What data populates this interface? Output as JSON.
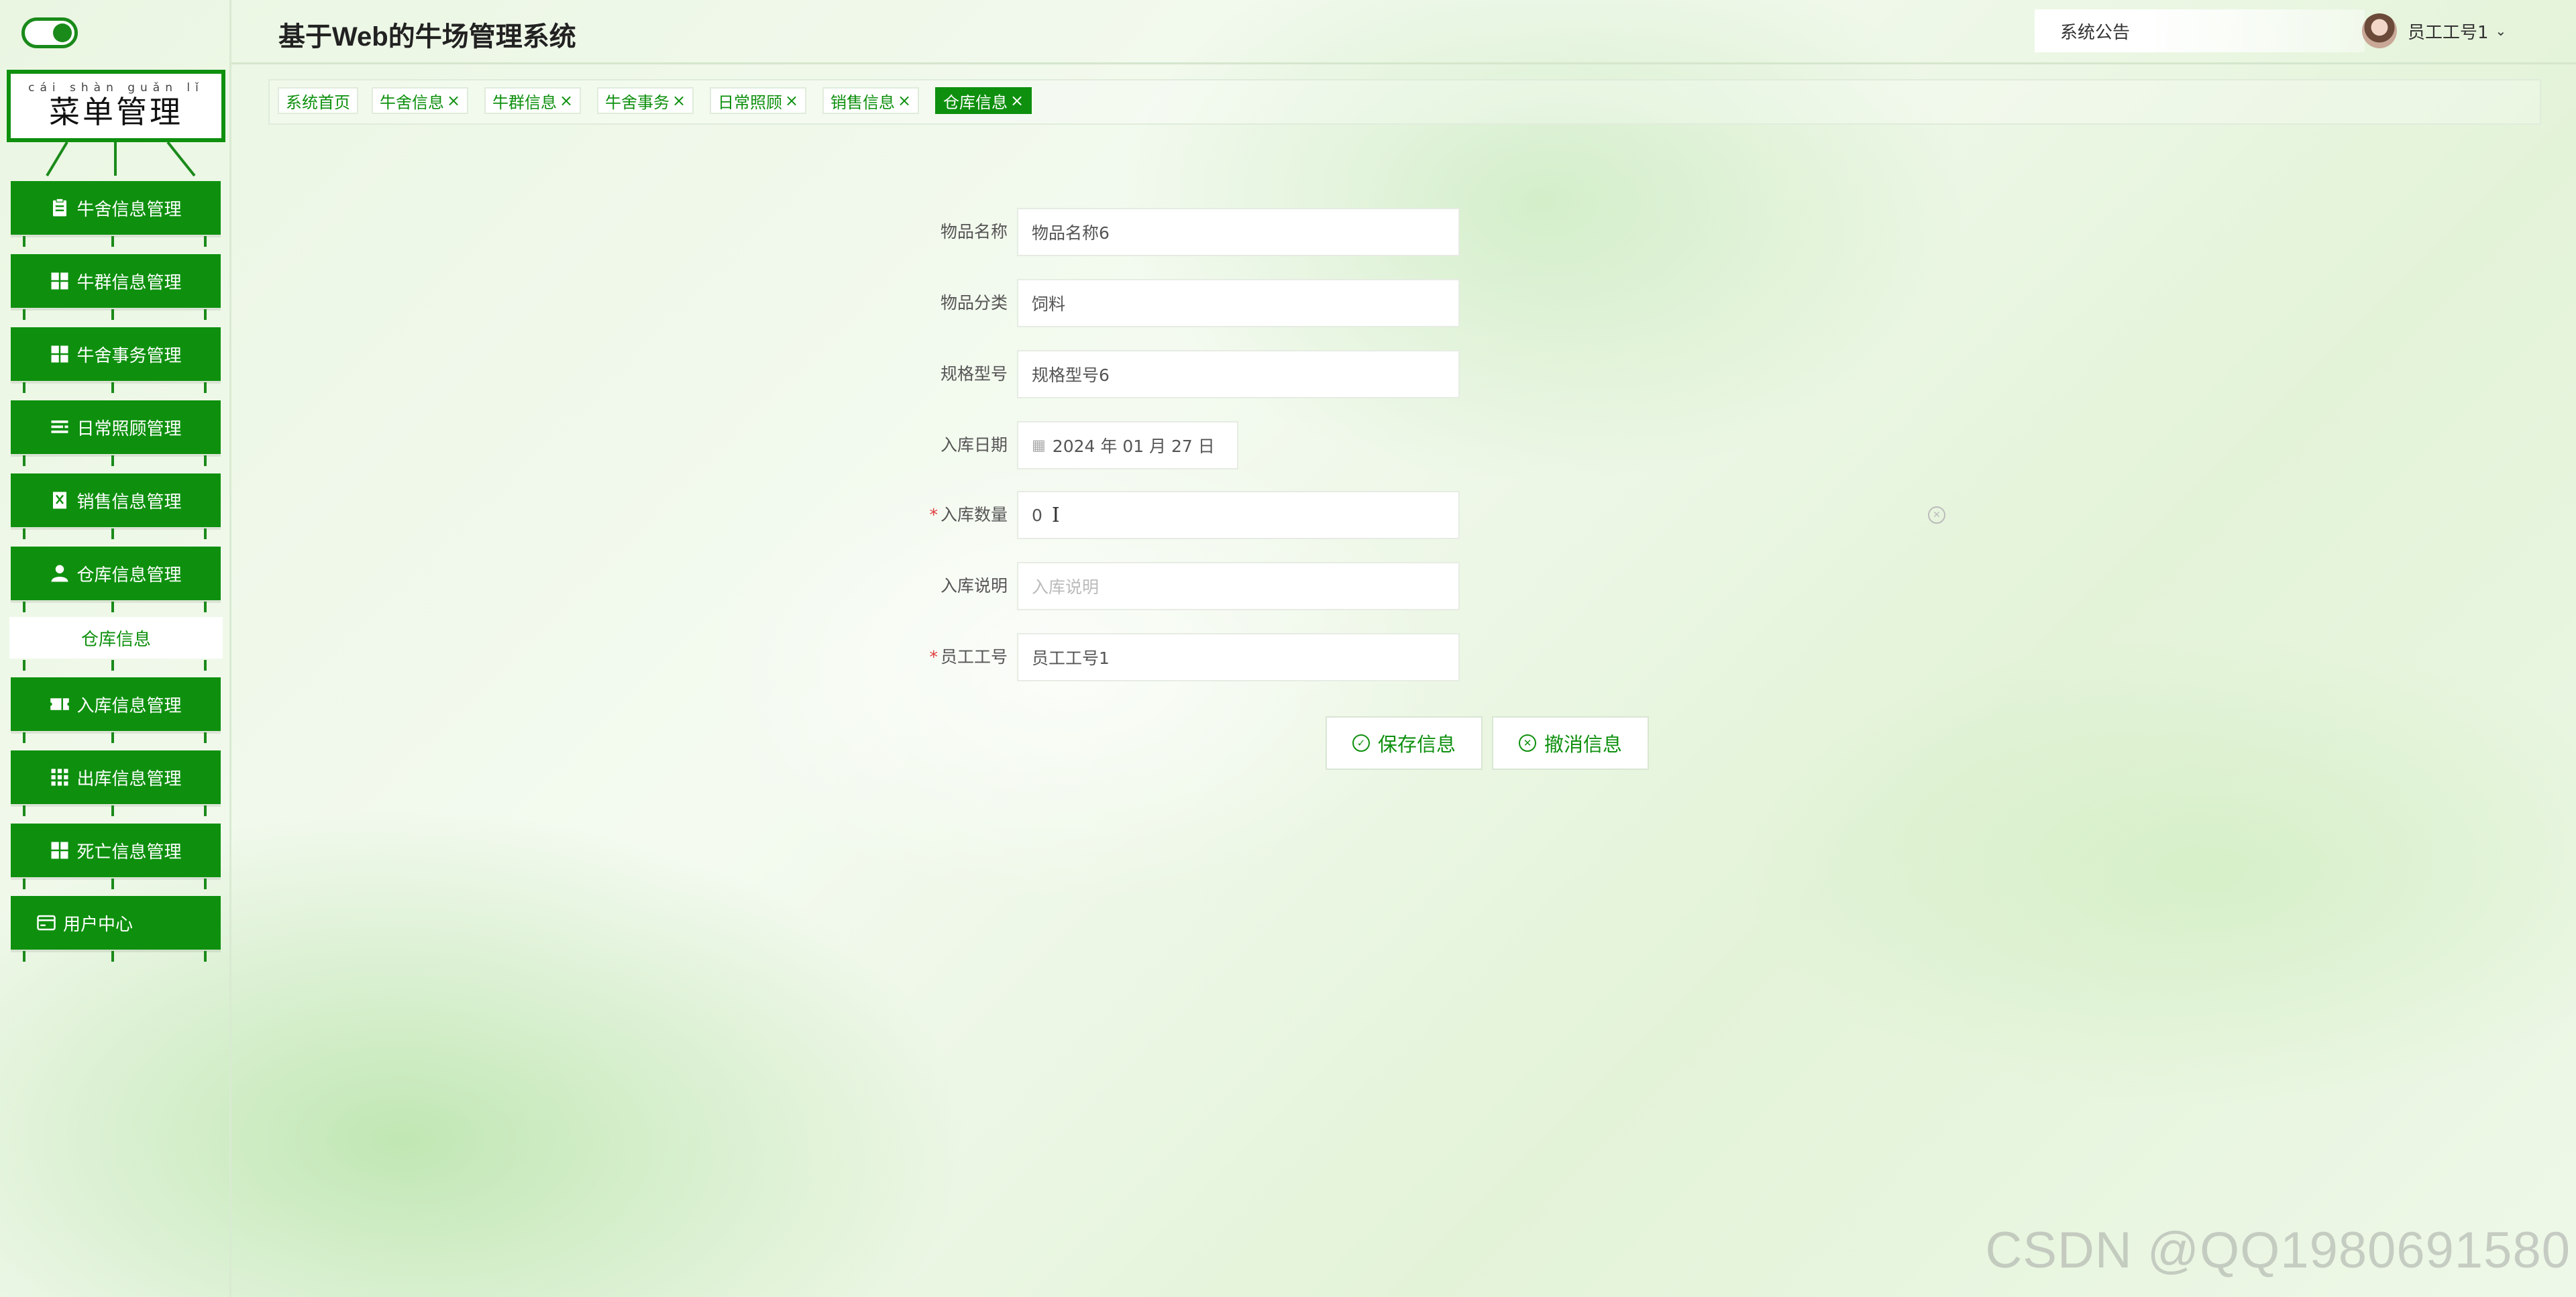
{
  "sidebar": {
    "menu_title_pinyin": "cái shàn guǎn lǐ",
    "menu_title": "菜单管理",
    "items": [
      {
        "label": "牛舍信息管理",
        "icon": "clipboard-icon"
      },
      {
        "label": "牛群信息管理",
        "icon": "grid-icon"
      },
      {
        "label": "牛舍事务管理",
        "icon": "grid-icon"
      },
      {
        "label": "日常照顾管理",
        "icon": "list-icon"
      },
      {
        "label": "销售信息管理",
        "icon": "receipt-icon"
      },
      {
        "label": "仓库信息管理",
        "icon": "user-icon"
      },
      {
        "label": "入库信息管理",
        "icon": "ticket-icon"
      },
      {
        "label": "出库信息管理",
        "icon": "apps-icon"
      },
      {
        "label": "死亡信息管理",
        "icon": "grid-icon"
      },
      {
        "label": "用户中心",
        "icon": "card-icon"
      }
    ],
    "sub_item": "仓库信息"
  },
  "header": {
    "title": "基于Web的牛场管理系统",
    "notice": "系统公告",
    "user": "员工工号1",
    "caret": "⌄"
  },
  "tabs": [
    {
      "label": "系统首页",
      "closable": false
    },
    {
      "label": "牛舍信息",
      "closable": true
    },
    {
      "label": "牛群信息",
      "closable": true
    },
    {
      "label": "牛舍事务",
      "closable": true
    },
    {
      "label": "日常照顾",
      "closable": true
    },
    {
      "label": "销售信息",
      "closable": true
    },
    {
      "label": "仓库信息",
      "closable": true,
      "active": true
    }
  ],
  "tab_close": "×",
  "form": {
    "item_name": {
      "label": "物品名称",
      "value": "物品名称6"
    },
    "item_category": {
      "label": "物品分类",
      "value": "饲料"
    },
    "spec_model": {
      "label": "规格型号",
      "value": "规格型号6"
    },
    "in_date": {
      "label": "入库日期",
      "value": "2024 年 01 月 27 日"
    },
    "in_quantity": {
      "label": "入库数量",
      "value": "0",
      "required": true
    },
    "in_desc": {
      "label": "入库说明",
      "placeholder": "入库说明"
    },
    "employee_no": {
      "label": "员工工号",
      "value": "员工工号1",
      "required": true
    }
  },
  "required_mark": "*",
  "buttons": {
    "save": "保存信息",
    "cancel": "撤消信息"
  },
  "watermark": "CSDN @QQ1980691580",
  "colors": {
    "primary": "#0e900e",
    "required": "#e03c3c"
  }
}
